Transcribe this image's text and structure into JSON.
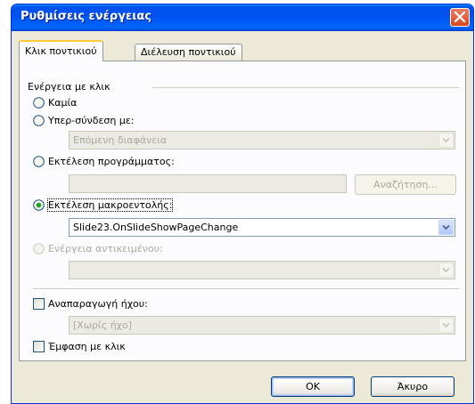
{
  "window": {
    "title": "Ρυθμίσεις ενέργειας"
  },
  "tabs": [
    {
      "label": "Κλικ ποντικιού",
      "active": true
    },
    {
      "label": "Διέλευση ποντικιού",
      "active": false
    }
  ],
  "group": {
    "label": "Ενέργεια με κλικ"
  },
  "options": {
    "none": "Καμία",
    "hyperlink": "Υπερ-σύνδεση με:",
    "hyperlink_value": "Επόμενη διαφάνεια",
    "run_program": "Εκτέλεση προγράμματος:",
    "run_program_value": "",
    "browse_button": "Αναζήτηση...",
    "run_macro": "Εκτέλεση μακροεντολής:",
    "run_macro_value": "Slide23.OnSlideShowPageChange",
    "object_action": "Ενέργεια αντικειμένου:",
    "object_action_value": "",
    "selected": "run_macro"
  },
  "sound": {
    "label": "Αναπαραγωγή ήχου:",
    "checked": false,
    "value": "[Χωρίς ήχο]"
  },
  "highlight": {
    "label": "Έμφαση με κλικ",
    "checked": false
  },
  "buttons": {
    "ok": "OK",
    "cancel": "Άκυρο"
  },
  "colors": {
    "titlebar": "#0054e3",
    "dialog": "#ece9d8",
    "focus_border": "#003c74"
  }
}
